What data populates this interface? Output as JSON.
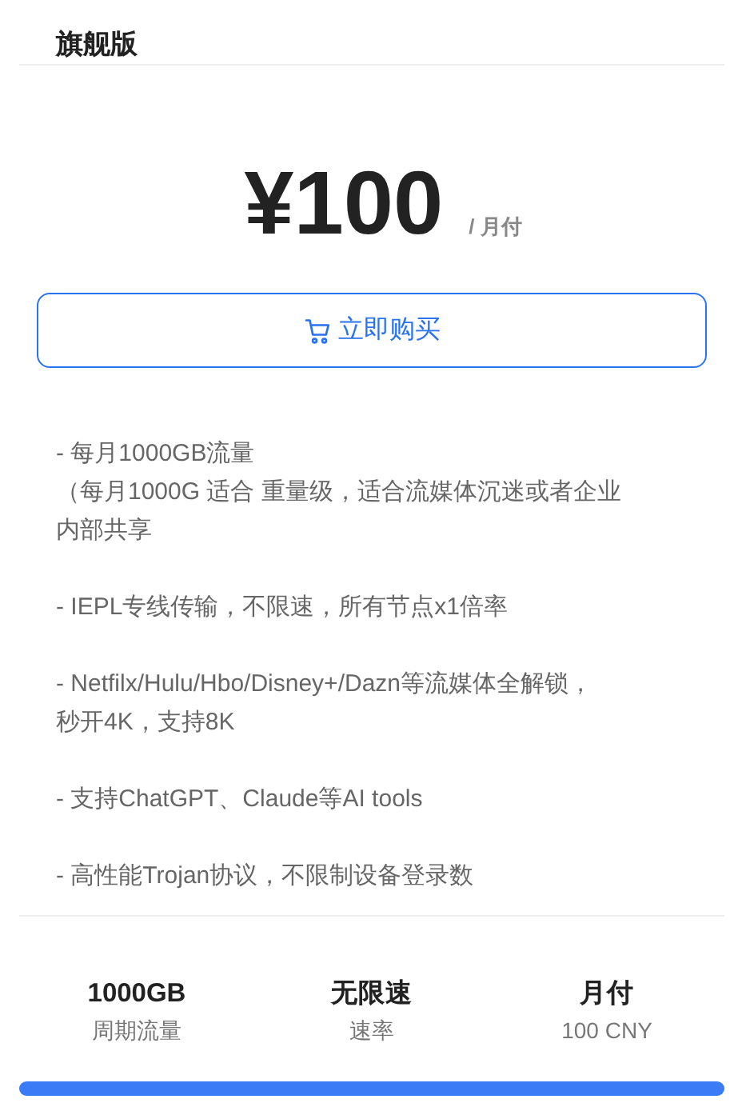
{
  "plan": {
    "title": "旗舰版"
  },
  "price": {
    "amount": "¥100",
    "period": "/ 月付"
  },
  "buy_button": {
    "label": "立即购买"
  },
  "features": [
    {
      "lines": [
        "- 每月1000GB流量",
        "（每月1000G 适合 重量级，适合流媒体沉迷或者企业",
        "内部共享"
      ]
    },
    {
      "lines": [
        "- IEPL专线传输，不限速，所有节点x1倍率"
      ]
    },
    {
      "lines": [
        "- Netfilx/Hulu/Hbo/Disney+/Dazn等流媒体全解锁，",
        "秒开4K，支持8K"
      ]
    },
    {
      "lines": [
        "- 支持ChatGPT、Claude等AI tools"
      ]
    },
    {
      "lines": [
        "- 高性能Trojan协议，不限制设备登录数"
      ]
    }
  ],
  "stats": [
    {
      "value": "1000GB",
      "label": "周期流量"
    },
    {
      "value": "无限速",
      "label": "速率"
    },
    {
      "value": "月付",
      "label": "100 CNY"
    }
  ]
}
